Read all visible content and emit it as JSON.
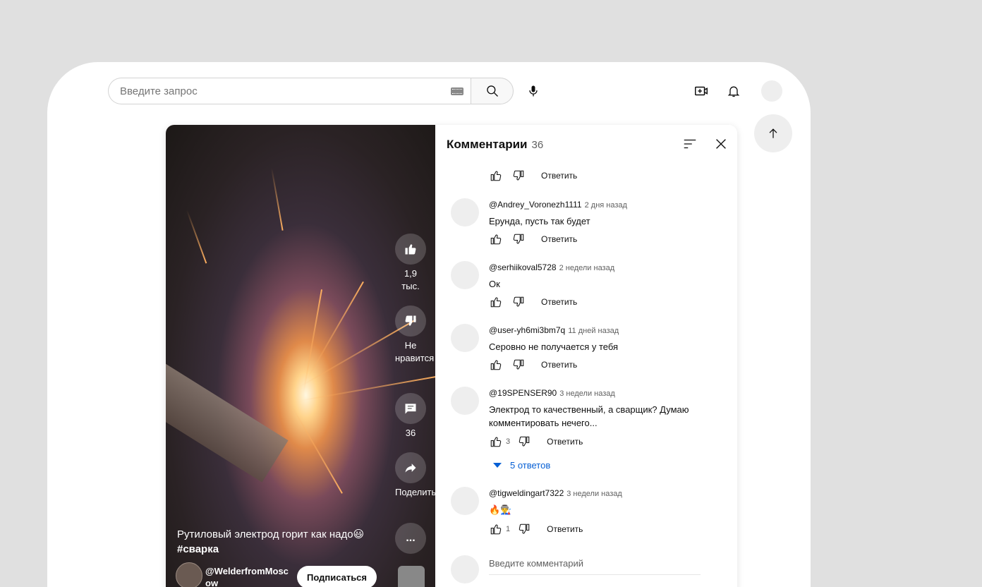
{
  "search": {
    "placeholder": "Введите запрос"
  },
  "video": {
    "title": "Рутиловый электрод горит как надо😃",
    "hashtag": "#сварка",
    "channel": "@WelderfromMoscow",
    "subscribe_label": "Подписаться",
    "likes": "1,9 тыс.",
    "dislike_label": "Не нравится",
    "comments_count": "36",
    "share_label": "Поделиться",
    "more_label": "..."
  },
  "comments_panel": {
    "title": "Комментарии",
    "count": "36",
    "reply_label": "Ответить",
    "top_actions": {
      "reply": "Ответить"
    },
    "comments": [
      {
        "author": "@Andrey_Voronezh1111",
        "time": "2 дня назад",
        "text": "Ерунда, пусть так будет",
        "likes": ""
      },
      {
        "author": "@serhiikoval5728",
        "time": "2 недели назад",
        "text": "Ок",
        "likes": ""
      },
      {
        "author": "@user-yh6mi3bm7q",
        "time": "11 дней назад",
        "text": "Серовно не получается у тебя",
        "likes": ""
      },
      {
        "author": "@19SPENSER90",
        "time": "3 недели назад",
        "text": "Электрод то качественный, а сварщик? Думаю комментировать нечего...",
        "likes": "3",
        "replies": "5 ответов"
      },
      {
        "author": "@tigweldingart7322",
        "time": "3 недели назад",
        "text": "🔥👨‍🏭",
        "likes": "1"
      }
    ],
    "input_placeholder": "Введите комментарий"
  },
  "colors": {
    "link_blue": "#065fd4",
    "text": "#0f0f0f",
    "muted": "#606060"
  },
  "icons": [
    "search-icon",
    "mic-icon",
    "create-icon",
    "bell-icon",
    "arrow-up-icon",
    "sort-icon",
    "close-icon",
    "like-icon",
    "dislike-icon",
    "comment-icon",
    "share-icon",
    "more-icon",
    "keyboard-icon"
  ]
}
